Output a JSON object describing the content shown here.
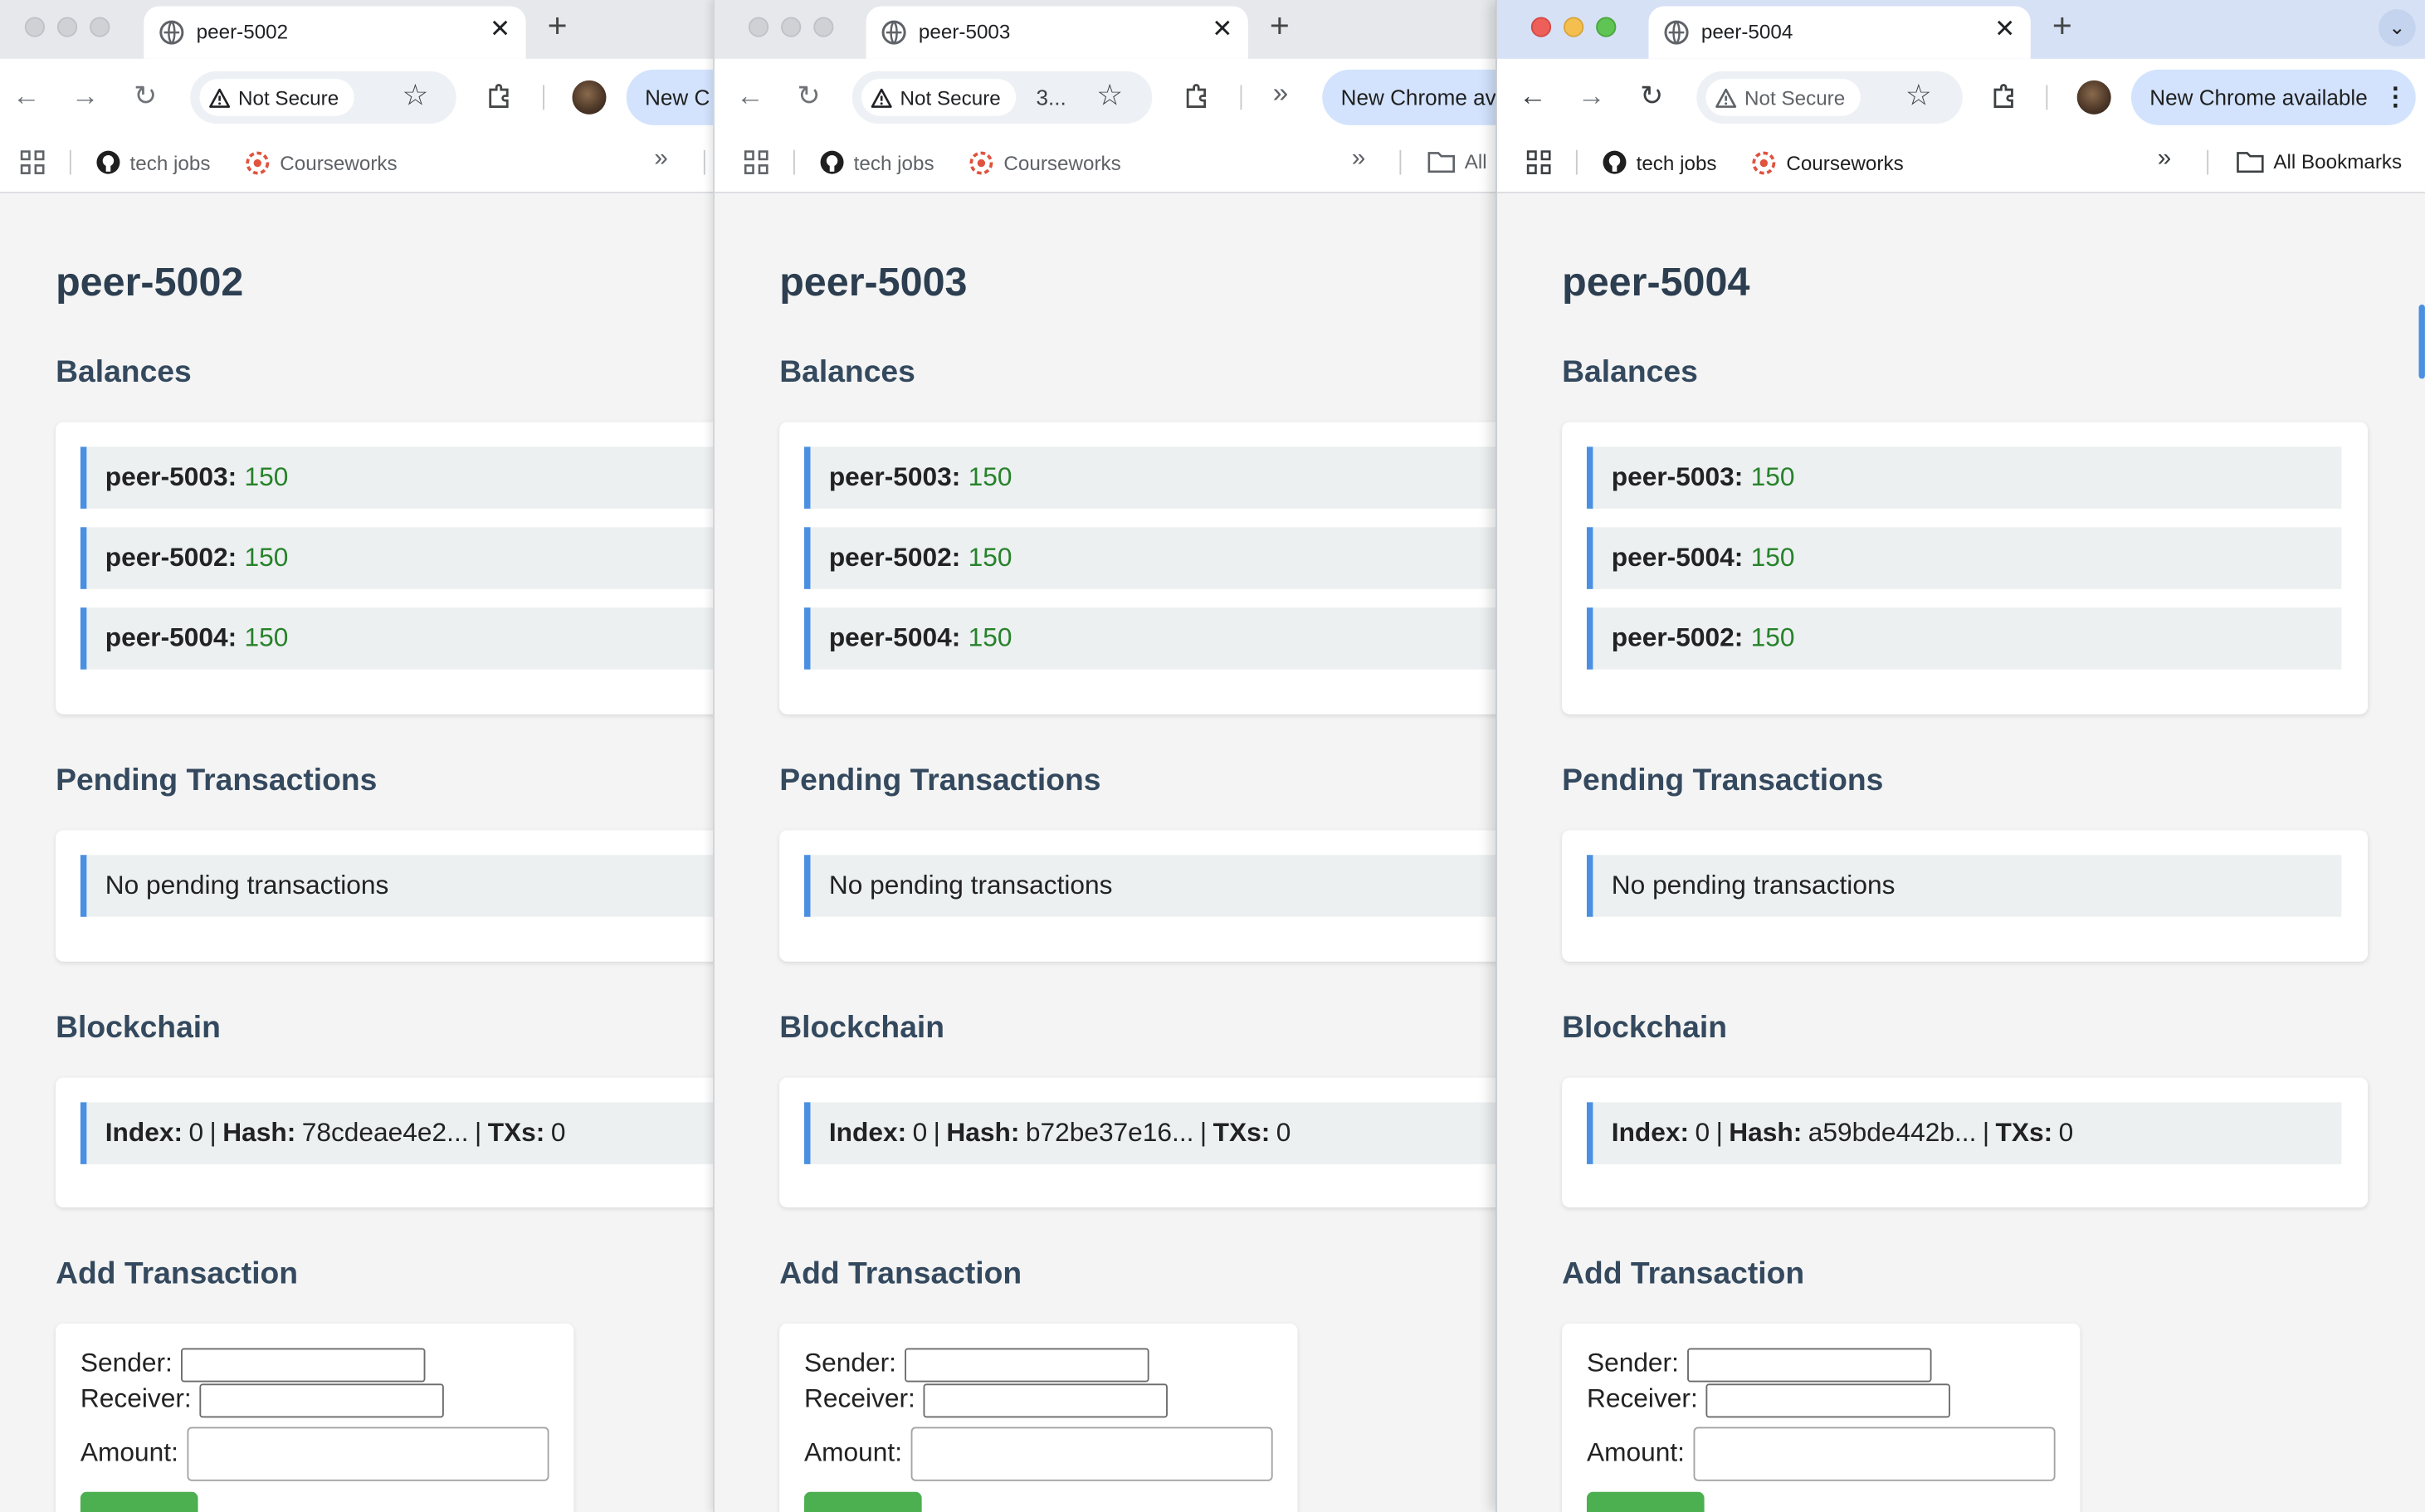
{
  "colors": {
    "accent_bar": "#4a90e2",
    "balance_value": "#27822a",
    "heading": "#2c3e50",
    "subheading": "#34495e",
    "submit_button": "#4caf50",
    "update_pill": "#d3e3fd"
  },
  "bookmarks": {
    "tech_jobs": "tech jobs",
    "courseworks": "Courseworks",
    "all_bookmarks": "All Bookmarks",
    "all_bookmarks_truncated": "All"
  },
  "browser": {
    "not_secure": "Not Secure",
    "omnibox_extra_w2": "3...",
    "update_w1": "New C",
    "update_w2": "New Chrome av",
    "update_w3": "New Chrome available"
  },
  "windows": [
    {
      "tab_title": "peer-5002",
      "peer_name": "peer-5002",
      "balances_heading": "Balances",
      "balances": [
        {
          "name": "peer-5003:",
          "amount": "150"
        },
        {
          "name": "peer-5002:",
          "amount": "150"
        },
        {
          "name": "peer-5004:",
          "amount": "150"
        }
      ],
      "pending_heading": "Pending Transactions",
      "pending_text": "No pending transactions",
      "blockchain_heading": "Blockchain",
      "block": {
        "index_label": "Index:",
        "index": "0",
        "hash_label": "Hash:",
        "hash": "78cdeae4e2...",
        "txs_label": "TXs:",
        "txs": "0"
      },
      "add_heading": "Add Transaction",
      "form": {
        "sender_label": "Sender:",
        "receiver_label": "Receiver:",
        "amount_label": "Amount:"
      }
    },
    {
      "tab_title": "peer-5003",
      "peer_name": "peer-5003",
      "balances_heading": "Balances",
      "balances": [
        {
          "name": "peer-5003:",
          "amount": "150"
        },
        {
          "name": "peer-5002:",
          "amount": "150"
        },
        {
          "name": "peer-5004:",
          "amount": "150"
        }
      ],
      "pending_heading": "Pending Transactions",
      "pending_text": "No pending transactions",
      "blockchain_heading": "Blockchain",
      "block": {
        "index_label": "Index:",
        "index": "0",
        "hash_label": "Hash:",
        "hash": "b72be37e16...",
        "txs_label": "TXs:",
        "txs": "0"
      },
      "add_heading": "Add Transaction",
      "form": {
        "sender_label": "Sender:",
        "receiver_label": "Receiver:",
        "amount_label": "Amount:"
      }
    },
    {
      "tab_title": "peer-5004",
      "peer_name": "peer-5004",
      "balances_heading": "Balances",
      "balances": [
        {
          "name": "peer-5003:",
          "amount": "150"
        },
        {
          "name": "peer-5004:",
          "amount": "150"
        },
        {
          "name": "peer-5002:",
          "amount": "150"
        }
      ],
      "pending_heading": "Pending Transactions",
      "pending_text": "No pending transactions",
      "blockchain_heading": "Blockchain",
      "block": {
        "index_label": "Index:",
        "index": "0",
        "hash_label": "Hash:",
        "hash": "a59bde442b...",
        "txs_label": "TXs:",
        "txs": "0"
      },
      "add_heading": "Add Transaction",
      "form": {
        "sender_label": "Sender:",
        "receiver_label": "Receiver:",
        "amount_label": "Amount:"
      }
    }
  ]
}
